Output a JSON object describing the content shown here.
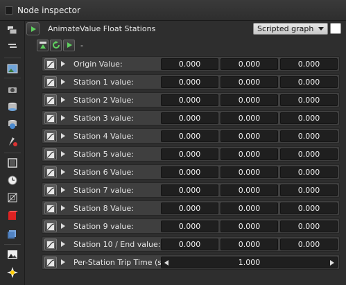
{
  "window": {
    "title": "Node inspector"
  },
  "node": {
    "name": "AnimateValue Float Stations",
    "graph_mode": "Scripted graph",
    "toolbar_dash": "-"
  },
  "sidebar_icons": [
    "layers-icon",
    "list-icon",
    "image-icon",
    "camera-icon",
    "database-icon",
    "database-globe-icon",
    "paint-brush-icon",
    "frame-icon",
    "clock-icon",
    "transform-icon",
    "red-cube-icon",
    "blue-cube-icon",
    "picture-icon",
    "light-burst-icon"
  ],
  "params": [
    {
      "label": "Origin Value:",
      "values": [
        "0.000",
        "0.000",
        "0.000"
      ]
    },
    {
      "label": "Station 1 value:",
      "values": [
        "0.000",
        "0.000",
        "0.000"
      ]
    },
    {
      "label": "Station 2 Value:",
      "values": [
        "0.000",
        "0.000",
        "0.000"
      ]
    },
    {
      "label": "Station 3 value:",
      "values": [
        "0.000",
        "0.000",
        "0.000"
      ]
    },
    {
      "label": "Station 4 Value:",
      "values": [
        "0.000",
        "0.000",
        "0.000"
      ]
    },
    {
      "label": "Station 5 value:",
      "values": [
        "0.000",
        "0.000",
        "0.000"
      ]
    },
    {
      "label": "Station 6 Value:",
      "values": [
        "0.000",
        "0.000",
        "0.000"
      ]
    },
    {
      "label": "Station 7 value:",
      "values": [
        "0.000",
        "0.000",
        "0.000"
      ]
    },
    {
      "label": "Station 8 Value:",
      "values": [
        "0.000",
        "0.000",
        "0.000"
      ]
    },
    {
      "label": "Station 9 value:",
      "values": [
        "0.000",
        "0.000",
        "0.000"
      ]
    },
    {
      "label": "Station 10 / End value:",
      "values": [
        "0.000",
        "0.000",
        "0.000"
      ]
    }
  ],
  "trip_time": {
    "label": "Per-Station Trip Time (sec):",
    "value": "1.000"
  }
}
